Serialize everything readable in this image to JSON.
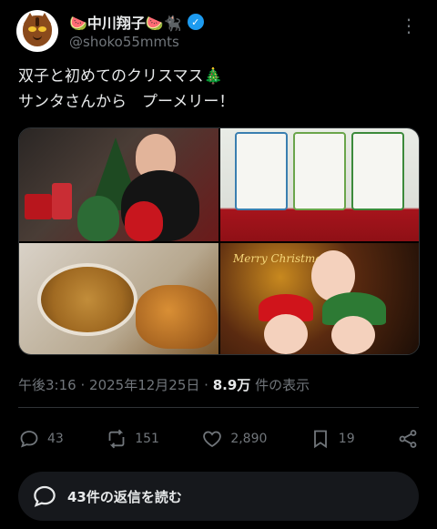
{
  "author": {
    "display_name": "🍉中川翔子🍉🐈‍⬛",
    "handle": "@shoko55mmts"
  },
  "menu_icon": "more-dots-icon",
  "tweet": {
    "line1": "双子と初めてのクリスマス🎄",
    "line2": "サンタさんから　プーメリー！"
  },
  "media": {
    "count": 4,
    "overlay_text": "Merry Christmas"
  },
  "meta": {
    "time": "午後3:16",
    "date": "2025年12月25日",
    "views_value": "8.9万",
    "views_suffix": "件の表示",
    "separator": "·"
  },
  "actions": {
    "replies": "43",
    "retweets": "151",
    "likes": "2,890",
    "bookmarks": "19"
  },
  "reply_bar": {
    "label": "43件の返信を読む"
  },
  "colors": {
    "background": "#000000",
    "text": "#e7e9ea",
    "muted": "#71767b",
    "verified": "#1d9bf0",
    "divider": "#2f3336"
  }
}
